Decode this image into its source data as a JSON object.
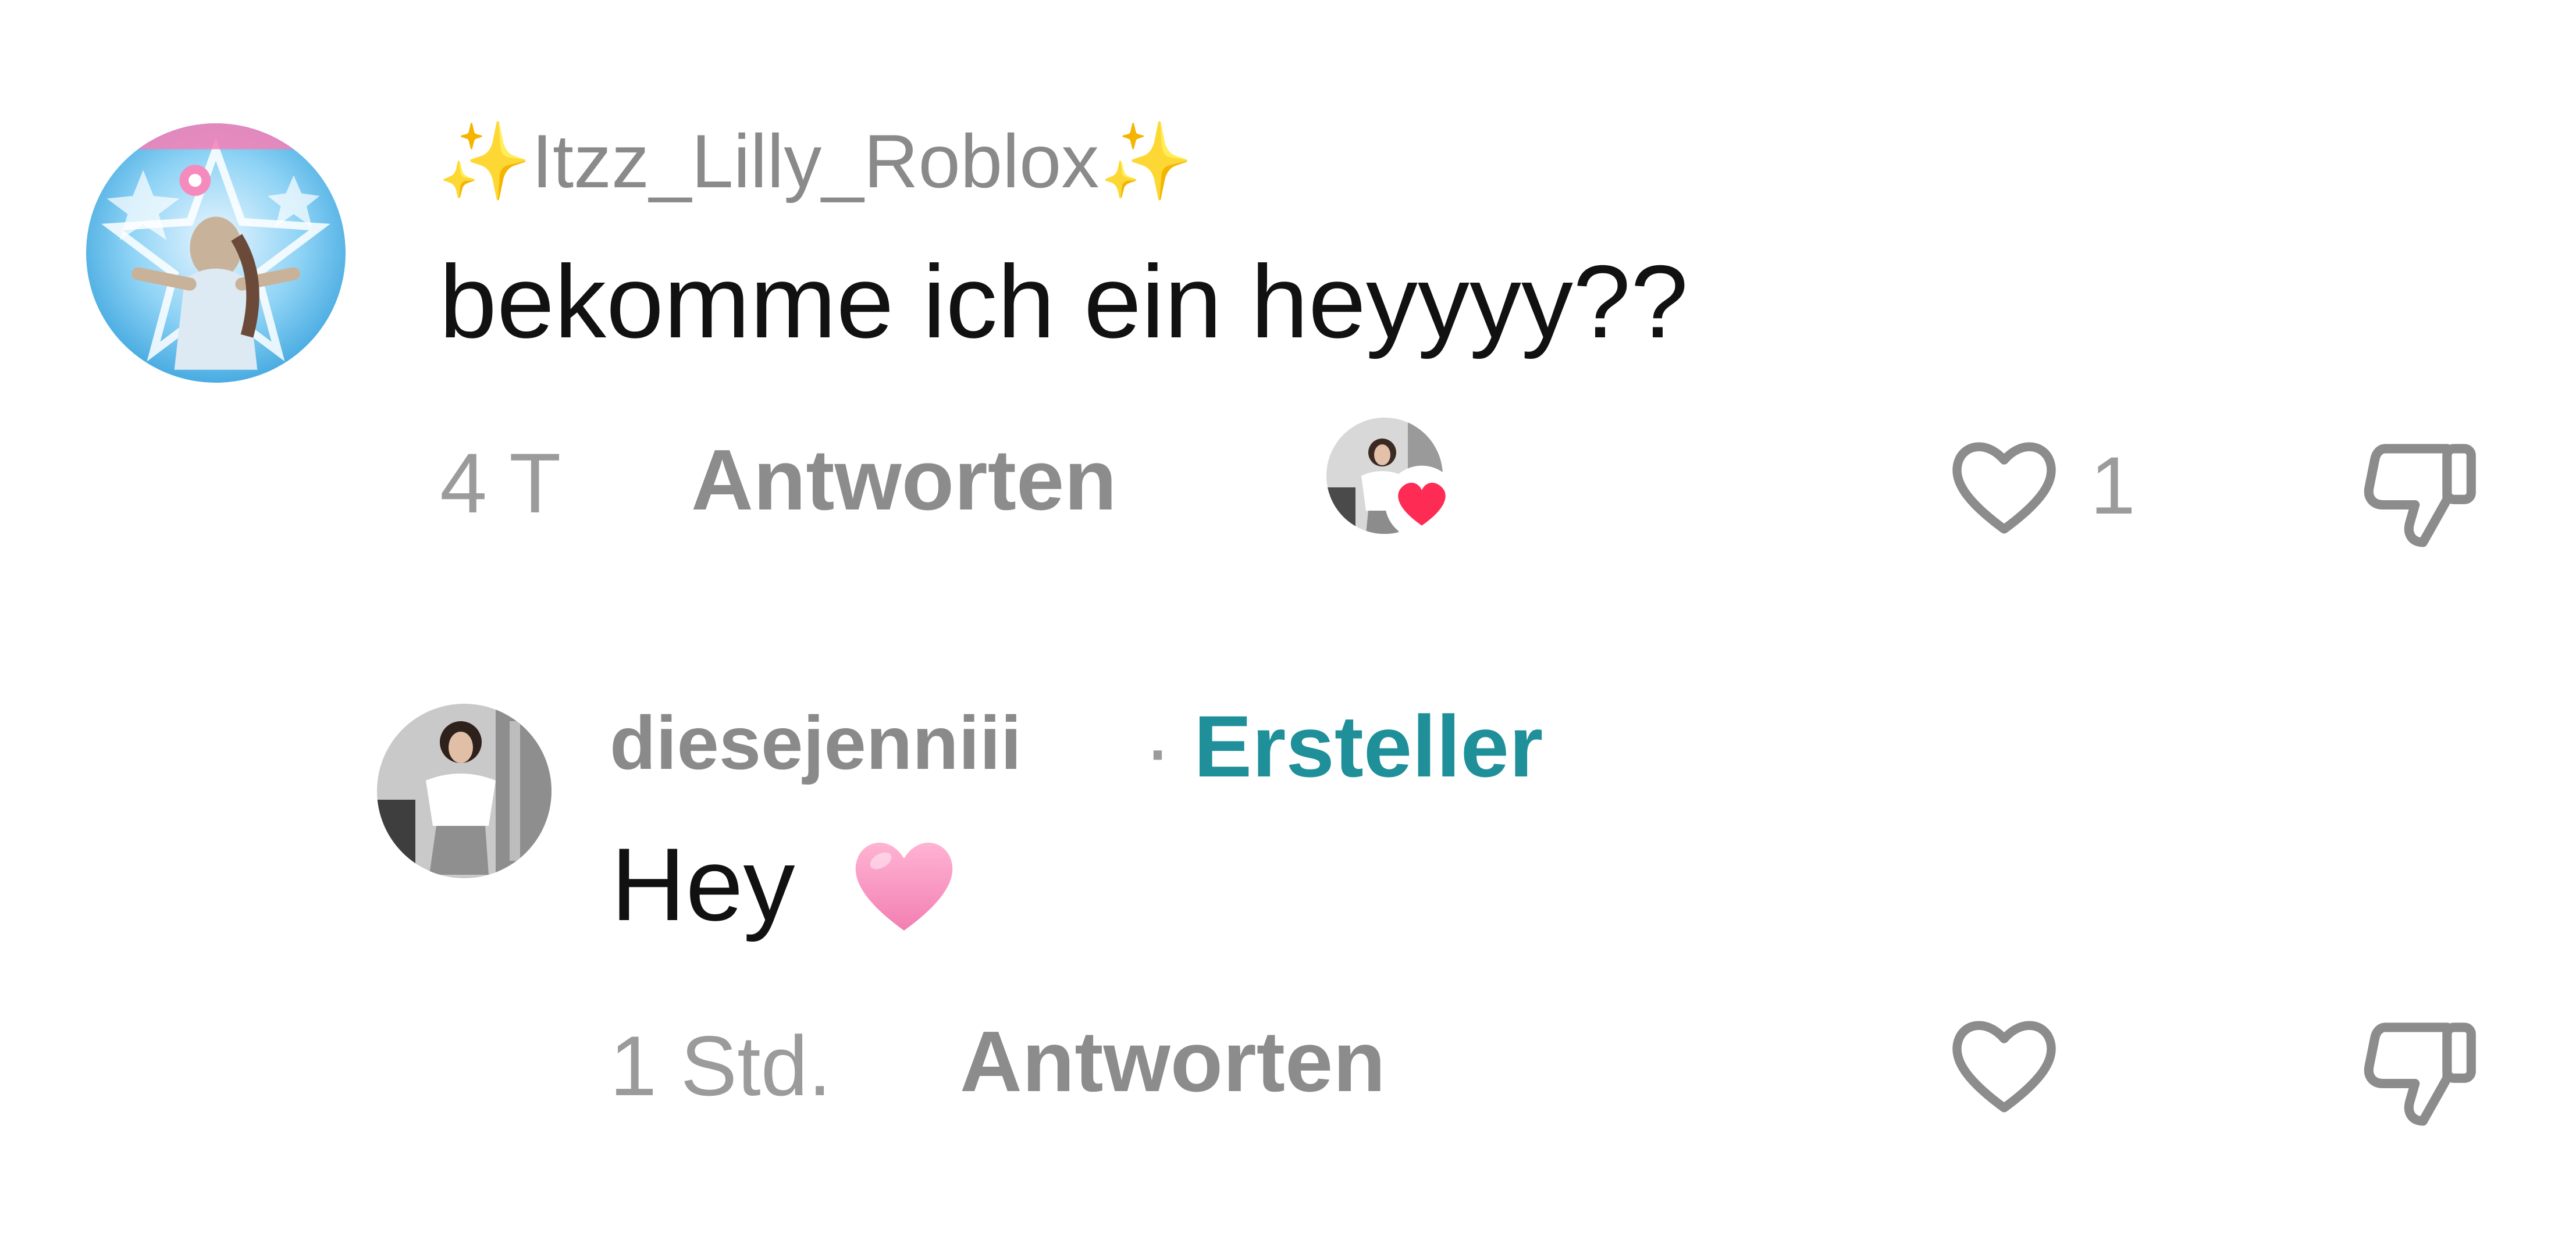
{
  "comment": {
    "username": "✨Itzz_Lilly_Roblox✨",
    "text": "bekomme ich ein heyyyy??",
    "time": "4 T",
    "reply_label": "Antworten",
    "like_count": "1",
    "liked_by_creator": true,
    "icons": {
      "like": "heart-outline-icon",
      "dislike": "thumbs-down-icon",
      "creator_like_badge": "heart-filled-icon"
    },
    "colors": {
      "creator_heart": "#fe2c55"
    }
  },
  "reply": {
    "username": "diesejenniii",
    "separator": "·",
    "creator_label": "Ersteller",
    "text": "Hey",
    "emoji": "🩷",
    "time": "1 Std.",
    "reply_label": "Antworten",
    "icons": {
      "like": "heart-outline-icon",
      "dislike": "thumbs-down-icon"
    },
    "colors": {
      "creator_label": "#1f8f99"
    }
  }
}
